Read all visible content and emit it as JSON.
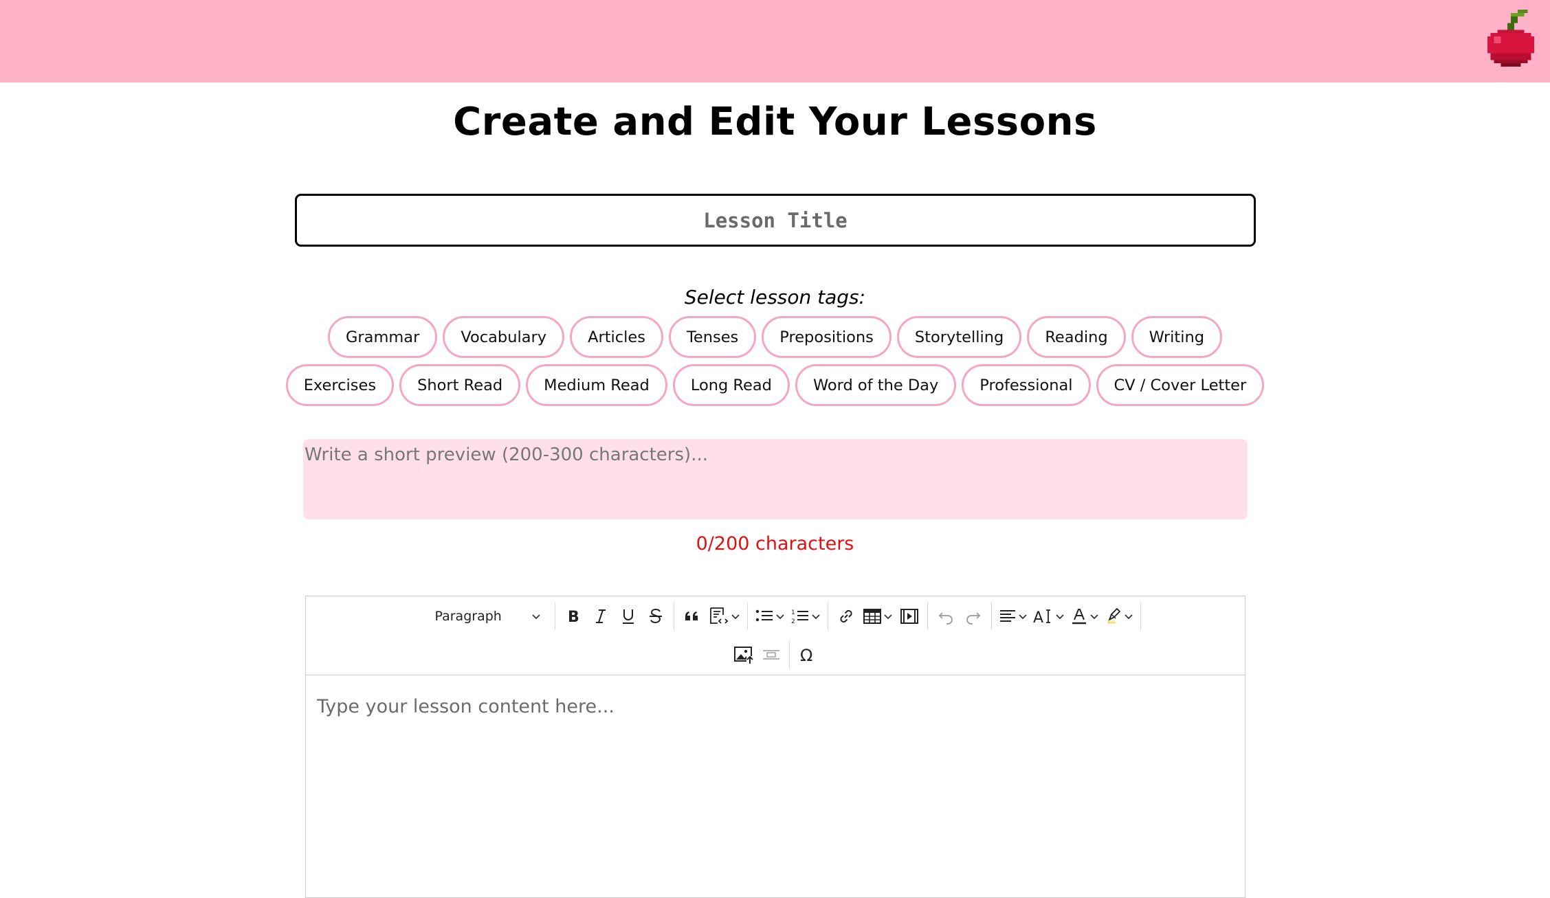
{
  "header": {
    "logo": "cherry-logo-icon",
    "bg_color": "#ffb1c8"
  },
  "page": {
    "title": "Create and Edit Your Lessons"
  },
  "lesson_title": {
    "placeholder": "Lesson Title"
  },
  "tags": {
    "label": "Select lesson tags:",
    "row1": [
      "Grammar",
      "Vocabulary",
      "Articles",
      "Tenses",
      "Prepositions",
      "Storytelling",
      "Reading",
      "Writing"
    ],
    "row2": [
      "Exercises",
      "Short Read",
      "Medium Read",
      "Long Read",
      "Word of the Day",
      "Professional",
      "CV / Cover Letter"
    ],
    "border_color": "#f5a6c4"
  },
  "preview": {
    "placeholder": "Write a short preview (200-300 characters)...",
    "count": "0/200 characters",
    "bg_color": "#ffe0e8",
    "count_color": "#e01010"
  },
  "editor": {
    "paragraph_label": "Paragraph",
    "placeholder": "Type your lesson content here...",
    "toolbar_icons": [
      "bold-icon",
      "italic-icon",
      "underline-icon",
      "strikethrough-icon",
      "blockquote-icon",
      "code-block-icon",
      "bulleted-list-icon",
      "numbered-list-icon",
      "link-icon",
      "table-icon",
      "media-embed-icon",
      "undo-icon",
      "redo-icon",
      "align-icon",
      "font-size-icon",
      "font-color-icon",
      "highlight-icon",
      "image-upload-icon",
      "horizontal-line-icon",
      "special-characters-icon"
    ]
  }
}
